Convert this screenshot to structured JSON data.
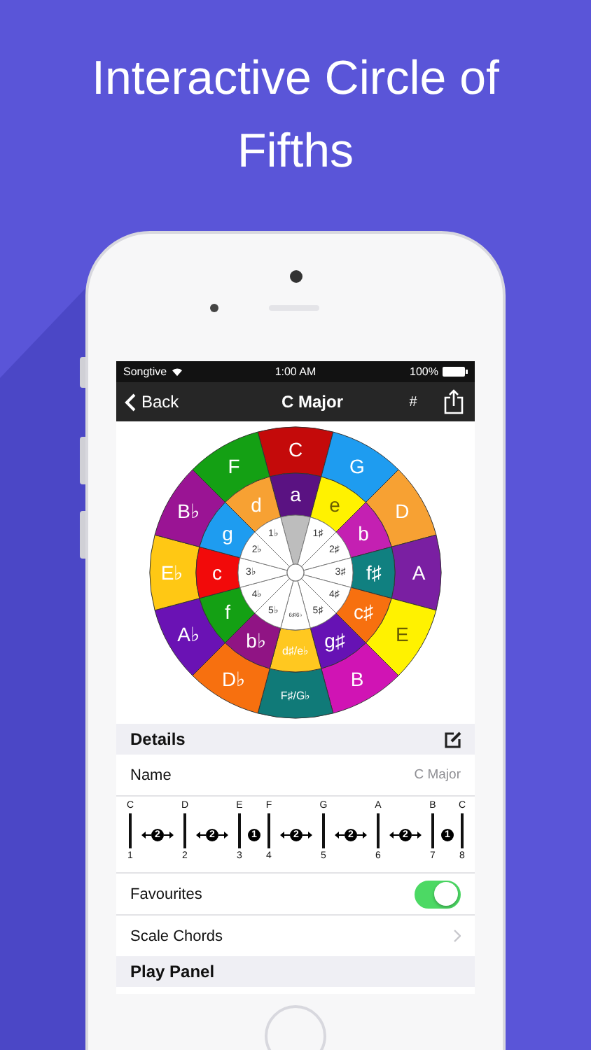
{
  "headline": "Interactive Circle of Fifths",
  "status_bar": {
    "carrier": "Songtive",
    "time": "1:00 AM",
    "battery": "100%"
  },
  "nav": {
    "back": "Back",
    "title": "C Major",
    "sharp_button": "#"
  },
  "circle": {
    "outer": [
      {
        "label": "C",
        "color": "#c40a0a"
      },
      {
        "label": "G",
        "color": "#1e9cf0"
      },
      {
        "label": "D",
        "color": "#f7a133"
      },
      {
        "label": "A",
        "color": "#7a1fa2"
      },
      {
        "label": "E",
        "color": "#fff200"
      },
      {
        "label": "B",
        "color": "#d014b4"
      },
      {
        "label": "F♯/G♭",
        "color": "#107a78"
      },
      {
        "label": "D♭",
        "color": "#f7700f"
      },
      {
        "label": "A♭",
        "color": "#6a12b4"
      },
      {
        "label": "E♭",
        "color": "#ffc814"
      },
      {
        "label": "B♭",
        "color": "#9a1494"
      },
      {
        "label": "F",
        "color": "#14a014"
      }
    ],
    "middle": [
      {
        "label": "a",
        "color": "#5a1282"
      },
      {
        "label": "e",
        "color": "#fff200"
      },
      {
        "label": "b",
        "color": "#c420b2"
      },
      {
        "label": "f♯",
        "color": "#108080"
      },
      {
        "label": "c♯",
        "color": "#f7700f"
      },
      {
        "label": "g♯",
        "color": "#6612b4"
      },
      {
        "label": "d♯/e♭",
        "color": "#ffc820"
      },
      {
        "label": "b♭",
        "color": "#901484"
      },
      {
        "label": "f",
        "color": "#14a014"
      },
      {
        "label": "c",
        "color": "#f20a0a"
      },
      {
        "label": "g",
        "color": "#1e9cf0"
      },
      {
        "label": "d",
        "color": "#f7a133"
      }
    ],
    "inner": [
      {
        "selected": true
      },
      {
        "label": "1♯",
        "selected": false
      },
      {
        "label": "2♯",
        "selected": false
      },
      {
        "label": "3♯",
        "selected": false
      },
      {
        "label": "4♯",
        "selected": false
      },
      {
        "label": "5♯",
        "selected": false
      },
      {
        "label": "6♯/6♭",
        "selected": false
      },
      {
        "label": "5♭",
        "selected": false
      },
      {
        "label": "4♭",
        "selected": false
      },
      {
        "label": "3♭",
        "selected": false
      },
      {
        "label": "2♭",
        "selected": false
      },
      {
        "label": "1♭",
        "selected": false
      }
    ]
  },
  "details": {
    "header": "Details",
    "name_label": "Name",
    "name_value": "C Major"
  },
  "scale": {
    "notes": [
      {
        "letter": "C",
        "degree": "1"
      },
      {
        "letter": "D",
        "degree": "2"
      },
      {
        "letter": "E",
        "degree": "3"
      },
      {
        "letter": "F",
        "degree": "4"
      },
      {
        "letter": "G",
        "degree": "5"
      },
      {
        "letter": "A",
        "degree": "6"
      },
      {
        "letter": "B",
        "degree": "7"
      },
      {
        "letter": "C",
        "degree": "8"
      }
    ],
    "steps": [
      {
        "kind": "whole",
        "label": "2"
      },
      {
        "kind": "whole",
        "label": "2"
      },
      {
        "kind": "half",
        "label": "1"
      },
      {
        "kind": "whole",
        "label": "2"
      },
      {
        "kind": "whole",
        "label": "2"
      },
      {
        "kind": "whole",
        "label": "2"
      },
      {
        "kind": "half",
        "label": "1"
      }
    ]
  },
  "favourites": {
    "label": "Favourites",
    "on": true
  },
  "scale_chords": "Scale Chords",
  "play_panel": "Play Panel"
}
